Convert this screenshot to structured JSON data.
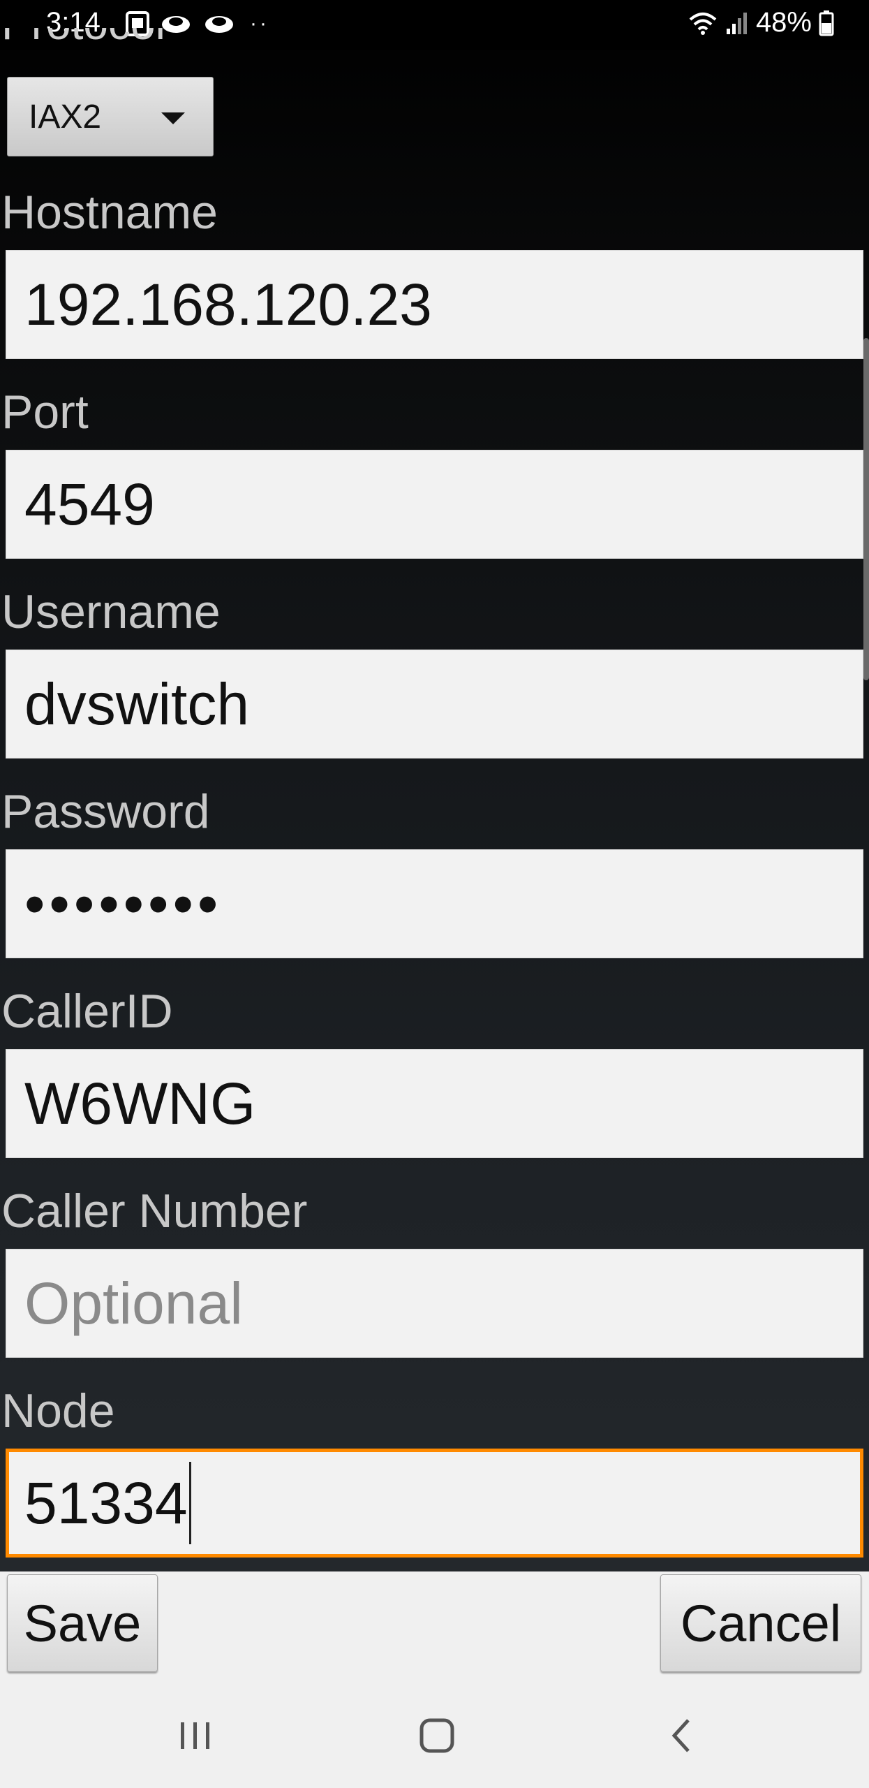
{
  "status_bar": {
    "time": "3:14",
    "battery": "48%",
    "left_icons": [
      "photo-notification-icon",
      "cloud-icon",
      "cloud-icon",
      "more-dots"
    ],
    "right_icons": [
      "wifi-icon",
      "signal-icon",
      "battery-icon"
    ],
    "more_indicator": "··"
  },
  "form": {
    "partial_label": "Protocol",
    "protocol_select": {
      "value": "IAX2"
    },
    "fields": {
      "hostname": {
        "label": "Hostname",
        "value": "192.168.120.23"
      },
      "port": {
        "label": "Port",
        "value": "4549"
      },
      "username": {
        "label": "Username",
        "value": "dvswitch"
      },
      "password": {
        "label": "Password",
        "value": "••••••••"
      },
      "callerid": {
        "label": "CallerID",
        "value": "W6WNG"
      },
      "caller_number": {
        "label": "Caller Number",
        "placeholder": "Optional"
      },
      "node": {
        "label": "Node",
        "value": "51334"
      }
    }
  },
  "buttons": {
    "save": "Save",
    "cancel": "Cancel"
  },
  "navbar": {
    "icons": [
      "recent-apps-icon",
      "home-icon",
      "back-icon"
    ]
  },
  "colors": {
    "focus_accent": "#ff8a00",
    "field_bg": "#f2f2f2",
    "label_text": "#c8c8c8"
  }
}
